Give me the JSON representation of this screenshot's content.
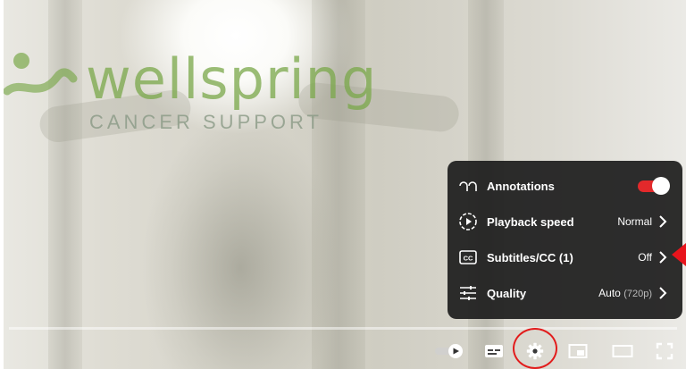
{
  "video": {
    "logo_text": "wellspring",
    "logo_subtext": "CANCER SUPPORT",
    "logo_color": "#7aa84a"
  },
  "settings_menu": {
    "items": [
      {
        "label": "Annotations",
        "icon": "annotations-icon",
        "control": "toggle",
        "toggle_on": true
      },
      {
        "label": "Playback speed",
        "icon": "playback-speed-icon",
        "value": "Normal"
      },
      {
        "label": "Subtitles/CC",
        "count": "(1)",
        "icon": "subtitles-icon",
        "value": "Off"
      },
      {
        "label": "Quality",
        "icon": "quality-icon",
        "value": "Auto",
        "value_sub": "(720p)"
      }
    ]
  },
  "controls": {
    "buttons": [
      "autoplay-toggle",
      "subtitles-button",
      "settings-button",
      "miniplayer-button",
      "theater-mode-button",
      "fullscreen-button"
    ]
  },
  "colors": {
    "accent_red": "#e3292b",
    "annotation_red": "#e21c1c",
    "menu_bg": "#1c1c1c"
  }
}
